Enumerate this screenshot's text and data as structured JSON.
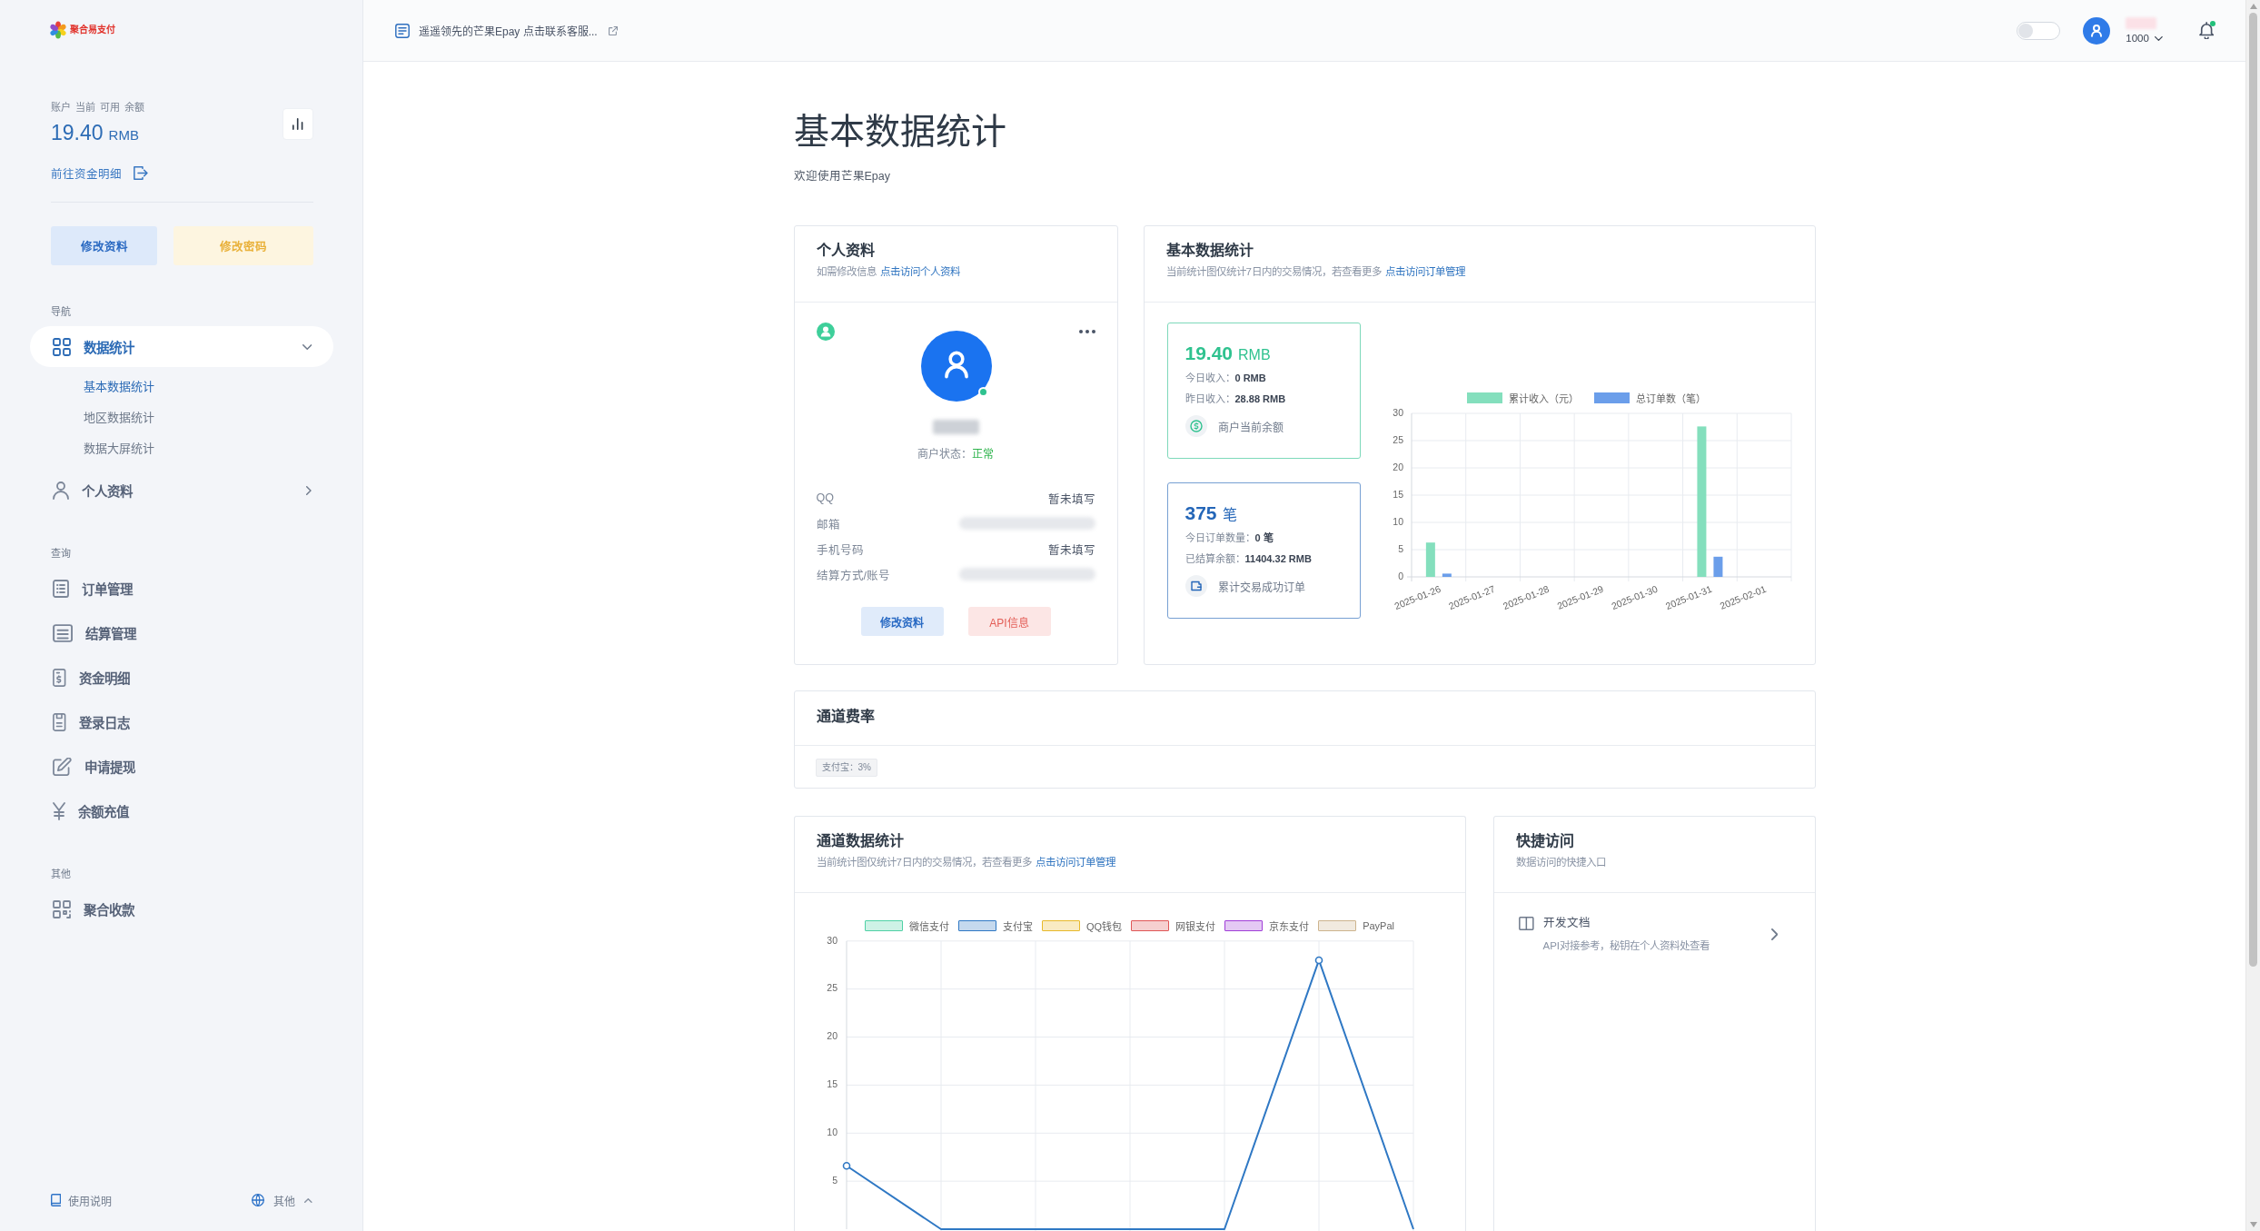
{
  "topbar": {
    "notice": "遥遥领先的芒果Epay 点击联系客服...",
    "switch": {
      "on": false
    },
    "user": {
      "name_hidden": true,
      "label": "1000"
    },
    "notifications": {
      "unread": true
    }
  },
  "sidebar": {
    "logo": "聚合易支付",
    "balance": {
      "label": "账户 当前 可用 余额",
      "amount": "19.40",
      "unit": "RMB",
      "link": "前往资金明细"
    },
    "buttons": [
      {
        "label": "修改资料",
        "kind": "primary"
      },
      {
        "label": "修改密码",
        "kind": "warning"
      }
    ],
    "sections": [
      {
        "title": "导航",
        "items": [
          {
            "label": "数据统计",
            "kind": "group",
            "selected": true,
            "expanded": true,
            "children": [
              {
                "label": "基本数据统计",
                "selected": true
              },
              {
                "label": "地区数据统计",
                "selected": false
              },
              {
                "label": "数据大屏统计",
                "selected": false
              }
            ]
          },
          {
            "label": "个人资料",
            "kind": "group",
            "selected": false,
            "expanded": false
          }
        ]
      },
      {
        "title": "查询",
        "items": [
          {
            "label": "订单管理",
            "kind": "link",
            "selected": false
          },
          {
            "label": "结算管理",
            "kind": "link",
            "selected": false
          },
          {
            "label": "资金明细",
            "kind": "link",
            "selected": false
          },
          {
            "label": "登录日志",
            "kind": "link",
            "selected": false
          },
          {
            "label": "申请提现",
            "kind": "link",
            "selected": false
          },
          {
            "label": "余额充值",
            "kind": "link",
            "selected": false
          }
        ]
      },
      {
        "title": "其他",
        "items": [
          {
            "label": "聚合收款",
            "kind": "link",
            "selected": false
          }
        ]
      }
    ],
    "footer": {
      "help": "使用说明",
      "other": "其他"
    }
  },
  "header": {
    "title": "基本数据统计",
    "subtitle": "欢迎使用芒果Epay"
  },
  "profile_card": {
    "title": "个人资料",
    "subtitle": "如需修改信息",
    "link": "点击访问个人资料",
    "online": true,
    "name_hidden": true,
    "status_label": "商户状态：",
    "status": "正常",
    "fields": [
      {
        "label": "QQ",
        "kind": "text",
        "value": "暂未填写"
      },
      {
        "label": "邮箱",
        "kind": "blurred"
      },
      {
        "label": "手机号码",
        "kind": "text",
        "value": "暂未填写"
      },
      {
        "label": "结算方式/账号",
        "kind": "blurred"
      }
    ],
    "buttons": [
      {
        "label": "修改资料",
        "kind": "primary"
      },
      {
        "label": "API信息",
        "kind": "danger"
      }
    ]
  },
  "stats_card": {
    "title": "基本数据统计",
    "subtitle": "当前统计图仅统计7日内的交易情况，若查看更多",
    "link": "点击访问订单管理",
    "tiles": [
      {
        "value": "19.40",
        "unit": "RMB",
        "color": "#2fc28f",
        "lines": [
          "今日收入：**0 RMB**",
          "昨日收入：**28.88 RMB**"
        ],
        "caption": "商户当前余额"
      },
      {
        "value": "375",
        "unit": "笔",
        "color": "#2466b8",
        "lines": [
          "今日订单数量：**0 笔**",
          "已结算余额：**11404.32 RMB**"
        ],
        "caption": "累计交易成功订单"
      }
    ],
    "chart_data": {
      "type": "bar",
      "legend": "top",
      "grid": true,
      "categories": [
        "2025-01-26",
        "2025-01-27",
        "2025-01-28",
        "2025-01-29",
        "2025-01-30",
        "2025-01-31",
        "2025-02-01"
      ],
      "series": [
        {
          "name": "累计收入（元）",
          "color": "#84dfbd",
          "values": [
            6.3,
            0,
            0,
            0,
            0,
            27.6,
            0
          ]
        },
        {
          "name": "总订单数（笔）",
          "color": "#6b9eea",
          "values": [
            0.6,
            0,
            0,
            0,
            0,
            3.7,
            0
          ]
        }
      ],
      "ylim": [
        0,
        30
      ],
      "yticks": [
        0,
        5,
        10,
        15,
        20,
        25,
        30
      ]
    }
  },
  "fee_card": {
    "title": "通道费率",
    "rates": [
      "支付宝：3%"
    ]
  },
  "channel_card": {
    "title": "通道数据统计",
    "subtitle": "当前统计图仅统计7日内的交易情况，若查看更多",
    "link": "点击访问订单管理",
    "chart_data": {
      "type": "line",
      "legend": "top",
      "grid": true,
      "categories": [
        null,
        null,
        null,
        null,
        null,
        null,
        null
      ],
      "series": [
        {
          "name": "微信支付",
          "color": "#4fd1a5",
          "values": [
            null,
            null,
            null,
            null,
            null,
            null,
            null
          ]
        },
        {
          "name": "支付宝",
          "color": "#2f78c4",
          "values": [
            6.6,
            0,
            0,
            0,
            0,
            28,
            0
          ]
        },
        {
          "name": "QQ钱包",
          "color": "#e8b92a",
          "values": [
            null,
            null,
            null,
            null,
            null,
            null,
            null
          ]
        },
        {
          "name": "网银支付",
          "color": "#e05656",
          "values": [
            null,
            null,
            null,
            null,
            null,
            null,
            null
          ]
        },
        {
          "name": "京东支付",
          "color": "#a03ed8",
          "values": [
            null,
            null,
            null,
            null,
            null,
            null,
            null
          ]
        },
        {
          "name": "PayPal",
          "color": "#cdb48e",
          "values": [
            null,
            null,
            null,
            null,
            null,
            null,
            null
          ]
        }
      ],
      "ylim": [
        0,
        30
      ],
      "yticks": [
        5,
        10,
        15,
        20,
        25,
        30
      ]
    }
  },
  "quick_card": {
    "title": "快捷访问",
    "subtitle": "数据访问的快捷入口",
    "items": [
      {
        "title": "开发文档",
        "description": "API对接参考，秘钥在个人资料处查看"
      }
    ]
  }
}
